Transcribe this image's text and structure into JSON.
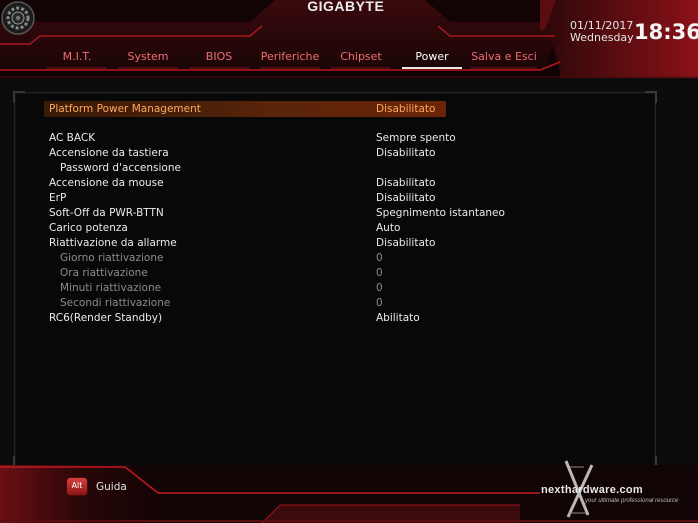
{
  "brand": "GIGABYTE",
  "brand_tm": "™",
  "datetime": {
    "date": "01/11/2017",
    "weekday": "Wednesday",
    "time": "18:36"
  },
  "tabs": [
    {
      "label": "M.I.T.",
      "active": false
    },
    {
      "label": "System",
      "active": false
    },
    {
      "label": "BIOS",
      "active": false
    },
    {
      "label": "Periferiche",
      "active": false
    },
    {
      "label": "Chipset",
      "active": false
    },
    {
      "label": "Power",
      "active": true
    },
    {
      "label": "Salva e Esci",
      "active": false
    }
  ],
  "settings": [
    {
      "label": "Platform Power Management",
      "value": "Disabilitato",
      "style": "selected"
    },
    {
      "label": "AC BACK",
      "value": "Sempre spento",
      "style": "normal"
    },
    {
      "label": "Accensione da tastiera",
      "value": "Disabilitato",
      "style": "normal"
    },
    {
      "label": "Password d'accensione",
      "value": "",
      "style": "sub"
    },
    {
      "label": "Accensione da mouse",
      "value": "Disabilitato",
      "style": "normal"
    },
    {
      "label": "ErP",
      "value": "Disabilitato",
      "style": "normal"
    },
    {
      "label": "Soft-Off da PWR-BTTN",
      "value": "Spegnimento istantaneo",
      "style": "normal"
    },
    {
      "label": "Carico potenza",
      "value": "Auto",
      "style": "normal"
    },
    {
      "label": "Riattivazione da allarme",
      "value": "Disabilitato",
      "style": "normal"
    },
    {
      "label": "Giorno riattivazione",
      "value": "0",
      "style": "dim-sub"
    },
    {
      "label": "Ora riattivazione",
      "value": "0",
      "style": "dim-sub"
    },
    {
      "label": "Minuti riattivazione",
      "value": "0",
      "style": "dim-sub"
    },
    {
      "label": "Secondi riattivazione",
      "value": "0",
      "style": "dim-sub"
    },
    {
      "label": "RC6(Render Standby)",
      "value": "Abilitato",
      "style": "normal"
    }
  ],
  "footer": {
    "key": "Alt",
    "help_label": "Guida"
  },
  "watermark": {
    "text": "nexthardware.com",
    "tagline": "your ultimate professional resource"
  },
  "colors": {
    "accent": "#e8232e",
    "tab_text": "#f06e72",
    "selected_text": "#ffa85a",
    "background": "#0c0c0d"
  }
}
